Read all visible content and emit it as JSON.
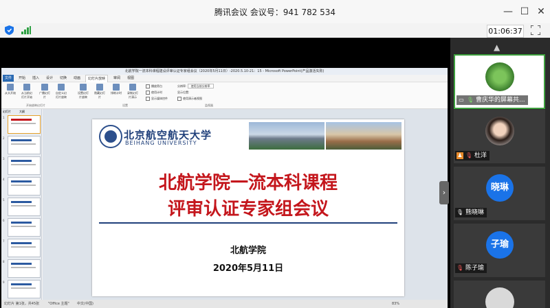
{
  "app": {
    "title": "腾讯会议 会议号：941 782 534",
    "window_controls": {
      "minimize": "—",
      "maximize": "☐",
      "close": "✕"
    },
    "timer": "01:06:37",
    "status_icons": [
      "shield-icon",
      "signal-icon",
      "fullscreen-icon"
    ]
  },
  "ppt": {
    "window_title": "北航学院一流本科课程建设评审认证专家组会议（2020年5月11日）-2020.5.10-21：15 - Microsoft PowerPoint(产品激活失败)",
    "menu": [
      "文件",
      "开始",
      "插入",
      "设计",
      "切换",
      "动画",
      "幻灯片放映",
      "审阅",
      "视图"
    ],
    "active_menu_index": 6,
    "ribbon_buttons": [
      "从头开始",
      "从当前幻灯片开始",
      "广播幻灯片",
      "自定义幻灯片放映",
      "设置幻灯片放映",
      "隐藏幻灯片",
      "排练计时",
      "录制幻灯片演示"
    ],
    "ribbon_checks": [
      "播放旁白",
      "使用计时",
      "显示媒体控件"
    ],
    "ribbon_monitor": {
      "resolution_label": "分辨率:",
      "resolution_value": "使用当前分辨率",
      "show_on_label": "显示位置:",
      "presenter_label": "使用演示者视图"
    },
    "ribbon_groups": [
      "开始放映幻灯片",
      "设置",
      "监视器"
    ],
    "panel_tabs": [
      "幻灯片",
      "大纲"
    ],
    "thumb_count": 9,
    "status": {
      "slide": "幻灯片 第1张，共45张",
      "theme": "\"Office 主题\"",
      "lang": "中文(中国)",
      "zoom": "83%"
    }
  },
  "slide": {
    "university_cn": "北京航空航天大学",
    "university_en": "BEIHANG UNIVERSITY",
    "title_line1": "北航学院一流本科课程",
    "title_line2": "评审认证专家组会议",
    "org": "北航学院",
    "date": "2020年5月11日"
  },
  "participants": [
    {
      "name": "曹庆华的屏幕共...",
      "type": "screen",
      "mic": "on",
      "active": true
    },
    {
      "name": "杜洋",
      "type": "photo",
      "mic": "muted"
    },
    {
      "name": "熊晓琳",
      "type": "initials",
      "initials": "晓琳",
      "color": "#1a73e8",
      "mic": "on"
    },
    {
      "name": "陈子瑜",
      "type": "initials",
      "initials": "子瑜",
      "color": "#1a73e8",
      "mic": "muted"
    },
    {
      "name": "",
      "type": "default"
    }
  ],
  "colors": {
    "accent_green": "#3da03d",
    "slide_red": "#c4161c",
    "slide_blue": "#1f3f7a",
    "avatar_blue": "#1a73e8"
  }
}
